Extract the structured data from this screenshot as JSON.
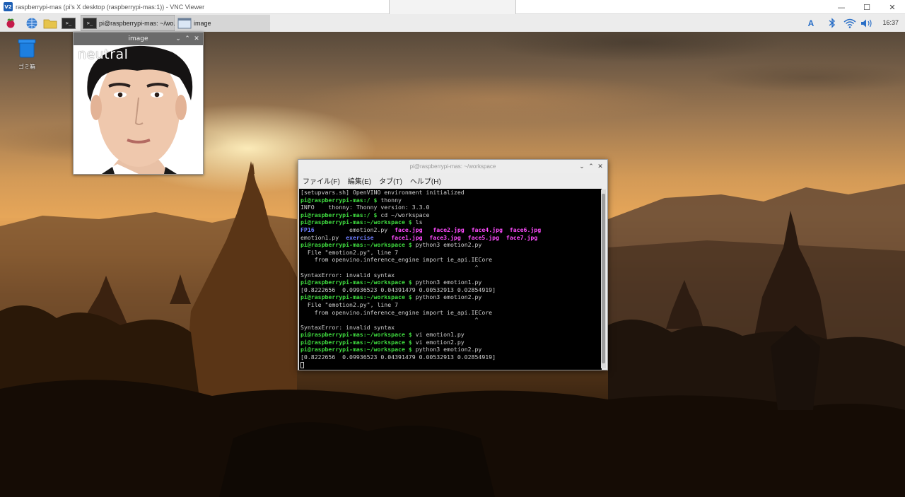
{
  "vnc": {
    "title": "raspberrypi-mas (pi's X desktop (raspberrypi-mas:1)) - VNC Viewer",
    "logo": "V2",
    "controls": [
      "—",
      "☐",
      "✕"
    ]
  },
  "panel": {
    "tasks": [
      {
        "label": "pi@raspberrypi-mas: ~/wo...",
        "icon": "terminal-icon",
        "active": true
      },
      {
        "label": "image",
        "icon": "window-icon",
        "active": false
      }
    ],
    "tray": {
      "input_method": "A",
      "clock": "16:37"
    }
  },
  "desktop": {
    "trash_label": "ゴミ箱"
  },
  "image_window": {
    "title": "image",
    "controls": [
      "⌄",
      "⌃",
      "✕"
    ],
    "emotion_label": "neutral"
  },
  "terminal": {
    "title": "pi@raspberrypi-mas: ~/workspace",
    "controls": [
      "⌄",
      "⌃",
      "✕"
    ],
    "menu": [
      "ファイル(F)",
      "編集(E)",
      "タブ(T)",
      "ヘルプ(H)"
    ],
    "lines": [
      [
        {
          "t": "[setupvars.sh] OpenVINO environment initialized",
          "c": ""
        }
      ],
      [
        {
          "t": "pi@raspberrypi-mas:/ $",
          "c": "g"
        },
        {
          "t": " thonny",
          "c": ""
        }
      ],
      [
        {
          "t": "INFO    thonny: Thonny version: 3.3.0",
          "c": ""
        }
      ],
      [
        {
          "t": "pi@raspberrypi-mas:/ $",
          "c": "g"
        },
        {
          "t": " cd ~/workspace",
          "c": ""
        }
      ],
      [
        {
          "t": "pi@raspberrypi-mas:~/workspace $",
          "c": "g"
        },
        {
          "t": " ls",
          "c": ""
        }
      ],
      [
        {
          "t": "FP16",
          "c": "b"
        },
        {
          "t": "          emotion2.py  ",
          "c": ""
        },
        {
          "t": "face.jpg",
          "c": "m"
        },
        {
          "t": "   ",
          "c": ""
        },
        {
          "t": "face2.jpg",
          "c": "m"
        },
        {
          "t": "  ",
          "c": ""
        },
        {
          "t": "face4.jpg",
          "c": "m"
        },
        {
          "t": "  ",
          "c": ""
        },
        {
          "t": "face6.jpg",
          "c": "m"
        }
      ],
      [
        {
          "t": "emotion1.py  ",
          "c": ""
        },
        {
          "t": "exercise",
          "c": "b"
        },
        {
          "t": "     ",
          "c": ""
        },
        {
          "t": "face1.jpg",
          "c": "m"
        },
        {
          "t": "  ",
          "c": ""
        },
        {
          "t": "face3.jpg",
          "c": "m"
        },
        {
          "t": "  ",
          "c": ""
        },
        {
          "t": "face5.jpg",
          "c": "m"
        },
        {
          "t": "  ",
          "c": ""
        },
        {
          "t": "face7.jpg",
          "c": "m"
        }
      ],
      [
        {
          "t": "pi@raspberrypi-mas:~/workspace $",
          "c": "g"
        },
        {
          "t": " python3 emotion2.py",
          "c": ""
        }
      ],
      [
        {
          "t": "  File \"emotion2.py\", line 7",
          "c": ""
        }
      ],
      [
        {
          "t": "    from openvino.inference_engine import ie_api.IECore",
          "c": ""
        }
      ],
      [
        {
          "t": "                                                  ^",
          "c": ""
        }
      ],
      [
        {
          "t": "SyntaxError: invalid syntax",
          "c": ""
        }
      ],
      [
        {
          "t": "pi@raspberrypi-mas:~/workspace $",
          "c": "g"
        },
        {
          "t": " python3 emotion1.py",
          "c": ""
        }
      ],
      [
        {
          "t": "[0.8222656  0.09936523 0.04391479 0.00532913 0.02854919]",
          "c": ""
        }
      ],
      [
        {
          "t": "pi@raspberrypi-mas:~/workspace $",
          "c": "g"
        },
        {
          "t": " python3 emotion2.py",
          "c": ""
        }
      ],
      [
        {
          "t": "  File \"emotion2.py\", line 7",
          "c": ""
        }
      ],
      [
        {
          "t": "    from openvino.inference_engine import ie_api.IECore",
          "c": ""
        }
      ],
      [
        {
          "t": "                                                  ^",
          "c": ""
        }
      ],
      [
        {
          "t": "SyntaxError: invalid syntax",
          "c": ""
        }
      ],
      [
        {
          "t": "pi@raspberrypi-mas:~/workspace $",
          "c": "g"
        },
        {
          "t": " vi emotion1.py",
          "c": ""
        }
      ],
      [
        {
          "t": "pi@raspberrypi-mas:~/workspace $",
          "c": "g"
        },
        {
          "t": " vi emotion2.py",
          "c": ""
        }
      ],
      [
        {
          "t": "pi@raspberrypi-mas:~/workspace $",
          "c": "g"
        },
        {
          "t": " python3 emotion2.py",
          "c": ""
        }
      ],
      [
        {
          "t": "[0.8222656  0.09936523 0.04391479 0.00532913 0.02854919]",
          "c": ""
        }
      ]
    ]
  },
  "colors": {
    "prompt": "#3fdc3f",
    "directory": "#6e7dff",
    "image_file": "#ff4cff",
    "tray_accent": "#2a6fc7"
  }
}
